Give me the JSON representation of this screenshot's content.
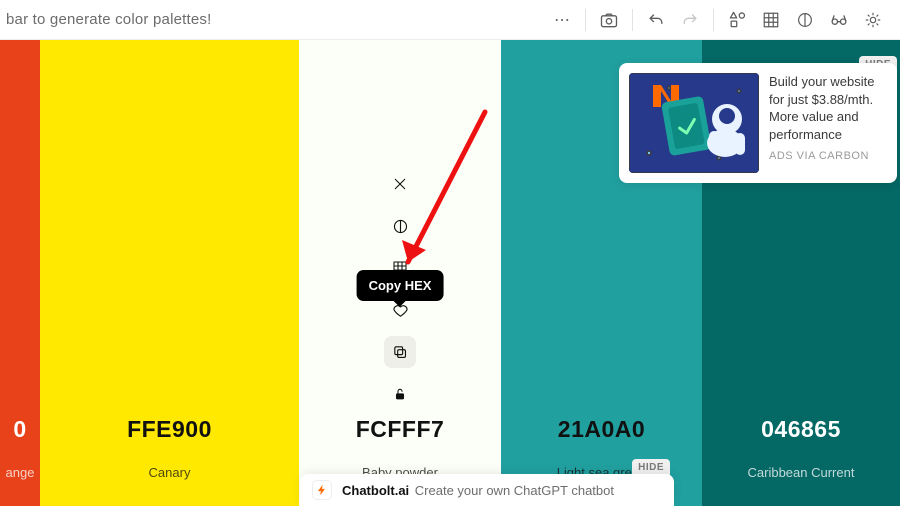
{
  "toolbar": {
    "hint": "bar to generate color palettes!"
  },
  "tooltip": {
    "copy_hex": "Copy HEX"
  },
  "columns": [
    {
      "hex": "0",
      "name": "ange",
      "bg": "#E74219",
      "fg": "#ffffff"
    },
    {
      "hex": "FFE900",
      "name": "Canary",
      "bg": "#FFE900",
      "fg": "#111111"
    },
    {
      "hex": "FCFFF7",
      "name": "Baby powder",
      "bg": "#FCFFF7",
      "fg": "#111111"
    },
    {
      "hex": "21A0A0",
      "name": "Light sea green",
      "bg": "#21A0A0",
      "fg": "#111111"
    },
    {
      "hex": "046865",
      "name": "Caribbean Current",
      "bg": "#046865",
      "fg": "#ffffff"
    }
  ],
  "ad": {
    "text": "Build your website for just $3.88/mth. More value and performance",
    "via": "ADS VIA CARBON",
    "hide": "HIDE"
  },
  "promo": {
    "brand": "Chatbolt.ai",
    "text": "Create your own ChatGPT chatbot",
    "hide": "HIDE"
  }
}
